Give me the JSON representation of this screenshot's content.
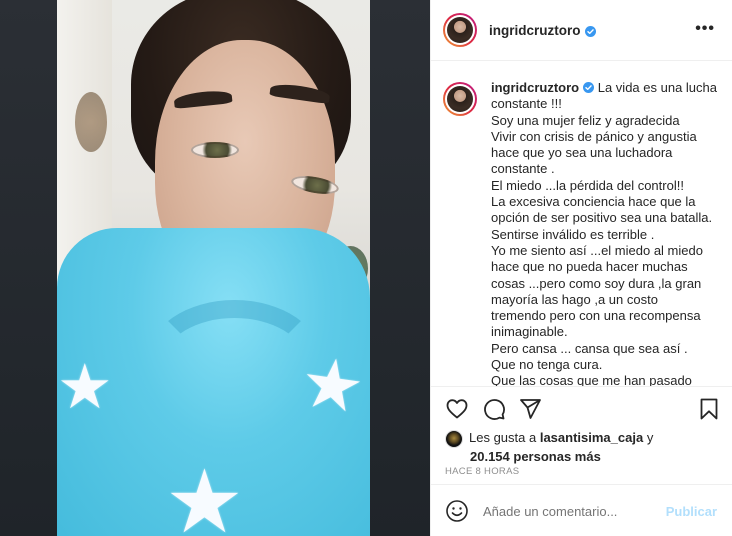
{
  "post": {
    "username": "ingridcruztoro",
    "more_icon": "more-horizontal-icon",
    "caption_lines": [
      "La vida es una lucha",
      "constante !!!",
      "Soy una mujer feliz y agradecida",
      "Vivir con crisis de pánico y angustia",
      "hace que yo sea una luchadora",
      "constante .",
      "El miedo ...la pérdida del control!!",
      "La excesiva conciencia hace que la",
      "opción de ser positivo sea una batalla.",
      "Sentirse inválido es terrible .",
      "Yo me siento así ...el miedo al miedo",
      "hace que no pueda hacer muchas",
      "cosas ...pero como soy dura ,la gran",
      "mayoría las hago ,a un costo",
      "tremendo pero con una recompensa",
      "inimaginable.",
      "Pero cansa ... cansa que sea así .",
      "Que no tenga cura.",
      "Que las cosas que me han pasado"
    ]
  },
  "actions": {
    "like_icon": "heart-icon",
    "comment_icon": "comment-icon",
    "share_icon": "paper-plane-icon",
    "save_icon": "bookmark-icon"
  },
  "likes": {
    "prefix": "Les gusta a",
    "user": "lasantisima_caja",
    "connector": "y",
    "count": "20.154 personas más"
  },
  "timestamp": "HACE 8 HORAS",
  "comment": {
    "placeholder": "Añade un comentario...",
    "publish_label": "Publicar",
    "emoji_icon": "smiley-icon"
  },
  "colors": {
    "verified": "#3897f0",
    "publish_disabled": "#b2dffc",
    "hoodie": "#5ecbe8"
  }
}
